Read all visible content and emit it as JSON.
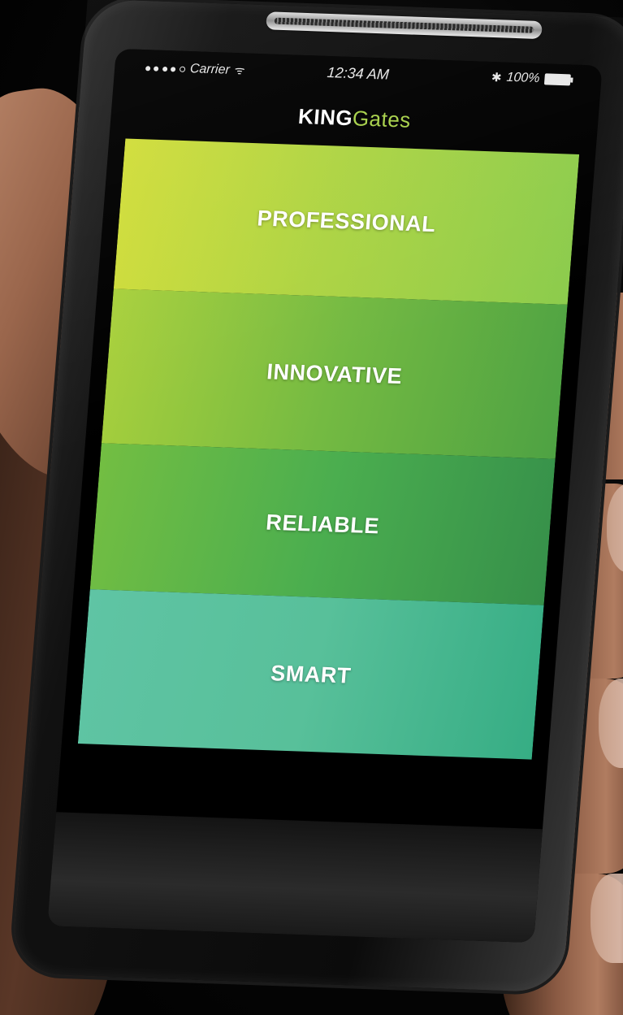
{
  "status_bar": {
    "carrier": "Carrier",
    "time": "12:34 AM",
    "battery": "100%",
    "icons": [
      "signal-dots-icon",
      "wifi-icon",
      "bluetooth-icon",
      "battery-icon"
    ]
  },
  "header": {
    "logo_primary": "KING",
    "logo_secondary": "Gates"
  },
  "menu": {
    "items": [
      {
        "label": "PROFESSIONAL",
        "color": "#b7d63f"
      },
      {
        "label": "INNOVATIVE",
        "color": "#7bbe42"
      },
      {
        "label": "RELIABLE",
        "color": "#4cae4b"
      },
      {
        "label": "SMART",
        "color": "#55bf98"
      }
    ]
  },
  "colors": {
    "brand_green": "#a8d14a",
    "screen_bg": "#000000"
  }
}
